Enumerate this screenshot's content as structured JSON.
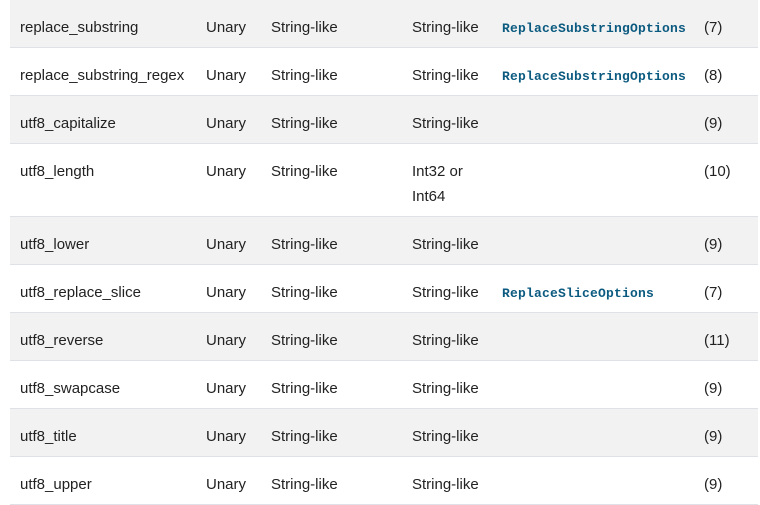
{
  "rows": [
    {
      "func": "replace_substring",
      "arity": "Unary",
      "input": "String-like",
      "output": "String-like",
      "options": "ReplaceSubstringOptions",
      "notes": "(7)"
    },
    {
      "func": "replace_substring_regex",
      "arity": "Unary",
      "input": "String-like",
      "output": "String-like",
      "options": "ReplaceSubstringOptions",
      "notes": "(8)"
    },
    {
      "func": "utf8_capitalize",
      "arity": "Unary",
      "input": "String-like",
      "output": "String-like",
      "options": "",
      "notes": "(9)"
    },
    {
      "func": "utf8_length",
      "arity": "Unary",
      "input": "String-like",
      "output": "Int32 or Int64",
      "options": "",
      "notes": "(10)"
    },
    {
      "func": "utf8_lower",
      "arity": "Unary",
      "input": "String-like",
      "output": "String-like",
      "options": "",
      "notes": "(9)"
    },
    {
      "func": "utf8_replace_slice",
      "arity": "Unary",
      "input": "String-like",
      "output": "String-like",
      "options": "ReplaceSliceOptions",
      "notes": "(7)"
    },
    {
      "func": "utf8_reverse",
      "arity": "Unary",
      "input": "String-like",
      "output": "String-like",
      "options": "",
      "notes": "(11)"
    },
    {
      "func": "utf8_swapcase",
      "arity": "Unary",
      "input": "String-like",
      "output": "String-like",
      "options": "",
      "notes": "(9)"
    },
    {
      "func": "utf8_title",
      "arity": "Unary",
      "input": "String-like",
      "output": "String-like",
      "options": "",
      "notes": "(9)"
    },
    {
      "func": "utf8_upper",
      "arity": "Unary",
      "input": "String-like",
      "output": "String-like",
      "options": "",
      "notes": "(9)"
    }
  ]
}
